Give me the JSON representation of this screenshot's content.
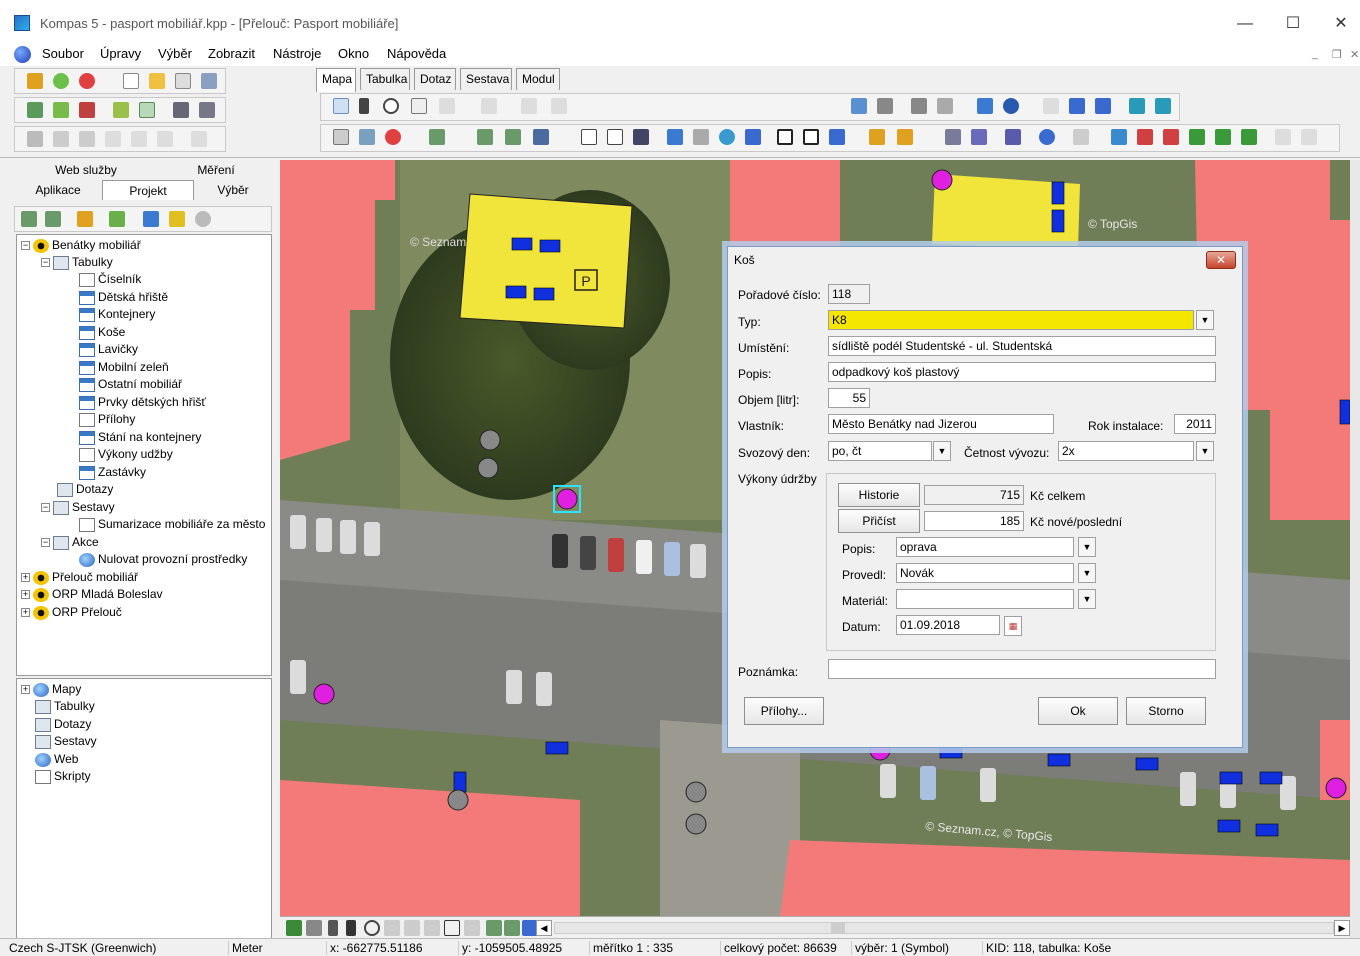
{
  "window": {
    "title": "Kompas 5 - pasport mobiliář.kpp - [Přelouč: Pasport mobiliáře]"
  },
  "menu": {
    "items": [
      "Soubor",
      "Úpravy",
      "Výběr",
      "Zobrazit",
      "Nástroje",
      "Okno",
      "Nápověda"
    ]
  },
  "main_tabs": [
    "Mapa",
    "Tabulka",
    "Dotaz",
    "Sestava",
    "Modul"
  ],
  "left_tabs": {
    "web": "Web služby",
    "mereni": "Měření",
    "aplikace": "Aplikace",
    "projekt": "Projekt",
    "vyber": "Výběr"
  },
  "tree": {
    "root": "Benátky mobiliář",
    "tabulky": "Tabulky",
    "tables": [
      "Číselník",
      "Dětská hřiště",
      "Kontejnery",
      "Koše",
      "Lavičky",
      "Mobilní zeleň",
      "Ostatní mobiliář",
      "Prvky dětských hřišť",
      "Přílohy",
      "Stání na kontejnery",
      "Výkony udžby",
      "Zastávky"
    ],
    "dotazy": "Dotazy",
    "sestavy": "Sestavy",
    "sestavy_item": "Sumarizace mobiliáře za město",
    "akce": "Akce",
    "akce_item": "Nulovat provozní prostředky",
    "others": [
      "Přelouč mobiliář",
      "ORP Mladá Boleslav",
      "ORP Přelouč"
    ]
  },
  "tree_bottom": [
    "Mapy",
    "Tabulky",
    "Dotazy",
    "Sestavy",
    "Web",
    "Skripty"
  ],
  "dialog": {
    "title": "Koš",
    "close": "✕",
    "poradove_label": "Pořadové číslo:",
    "poradove_value": "118",
    "typ_label": "Typ:",
    "typ_value": "K8",
    "umisteni_label": "Umístění:",
    "umisteni_value": "sídliště podél Studentské - ul. Studentská",
    "popis_label": "Popis:",
    "popis_value": "odpadkový koš plastový",
    "objem_label": "Objem [litr]:",
    "objem_value": "55",
    "vlastnik_label": "Vlastník:",
    "vlastnik_value": "Město Benátky nad Jizerou",
    "rok_label": "Rok instalace:",
    "rok_value": "2011",
    "svoz_label": "Svozový den:",
    "svoz_value": "po, čt",
    "cetnost_label": "Četnost vývozu:",
    "cetnost_value": "2x",
    "vykony_label": "Výkony údržby",
    "historie_btn": "Historie",
    "historie_value": "715",
    "historie_unit": "Kč celkem",
    "pricist_btn": "Přičíst",
    "pricist_value": "185",
    "pricist_unit": "Kč nové/poslední",
    "v_popis_label": "Popis:",
    "v_popis_value": "oprava",
    "provedl_label": "Provedl:",
    "provedl_value": "Novák",
    "material_label": "Materiál:",
    "material_value": "",
    "datum_label": "Datum:",
    "datum_value": "01.09.2018",
    "poznamka_label": "Poznámka:",
    "poznamka_value": "",
    "prilohy_btn": "Přílohy...",
    "ok_btn": "Ok",
    "storno_btn": "Storno"
  },
  "map_labels": {
    "p_sign": "P",
    "watermark1": "© Seznam.cz, © TopGis",
    "watermark2": "© TopGis",
    "watermark3": "© Seznam"
  },
  "status": {
    "crs": "Czech S-JTSK (Greenwich)",
    "unit": "Meter",
    "x": "x: -662775.51186",
    "y": "y: -1059505.48925",
    "scale": "měřítko 1 : 335",
    "total": "celkový počet: 86639",
    "selection": "výběr: 1 (Symbol)",
    "kid": "KID: 118, tabulka: Koše"
  },
  "colors": {
    "building": "#f47a7a",
    "parking": "#f1e43a",
    "bin": "#1030e0",
    "selected": "#e020e0",
    "dialog_highlight": "#f5e600"
  }
}
